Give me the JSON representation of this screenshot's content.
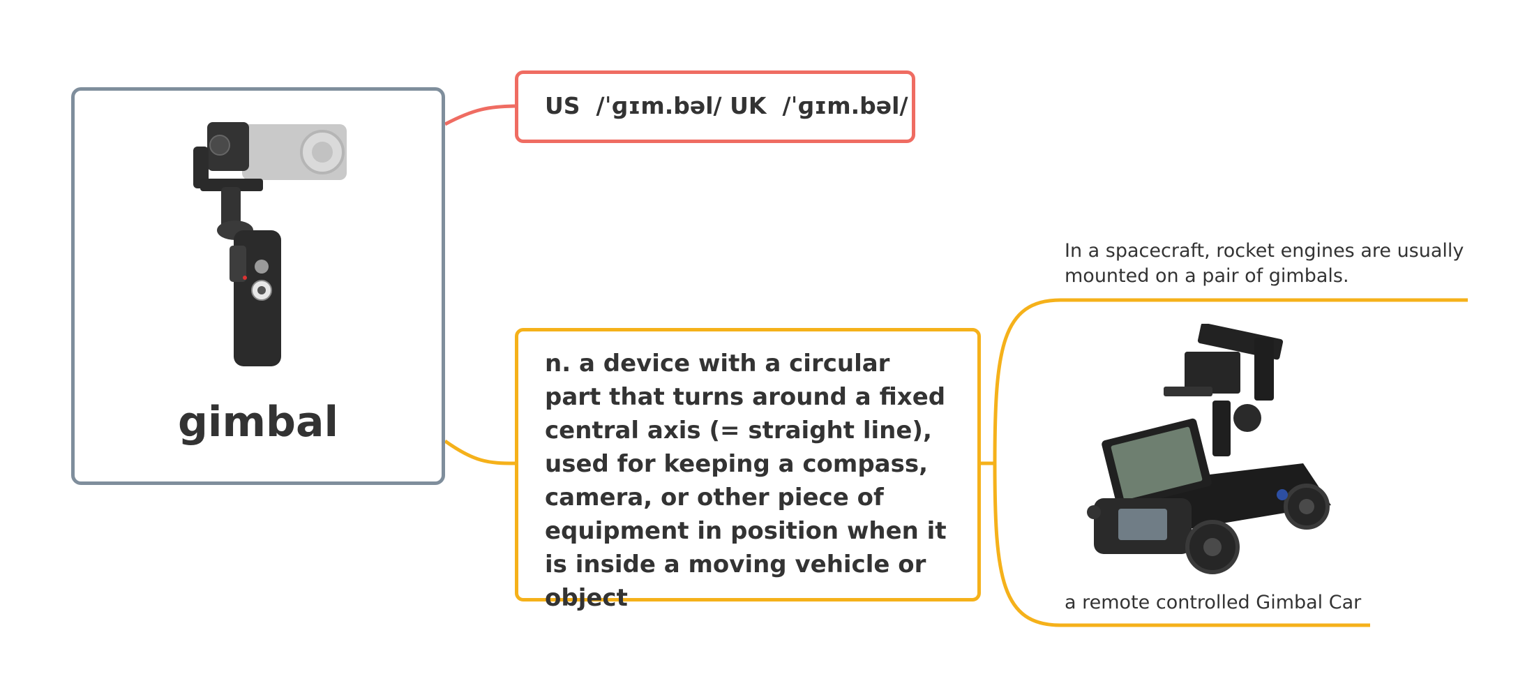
{
  "root": {
    "word": "gimbal",
    "image_icon": "handheld-gimbal-stabilizer-icon",
    "border_color": "#7f8e9c"
  },
  "pronunciation": {
    "text": "US  /ˈɡɪm.bəl/ UK  /ˈɡɪm.bəl/",
    "border_color": "#ef6c62"
  },
  "definition": {
    "text": "n. a device with a circular part that turns around a fixed central axis (= straight line), used for keeping a compass, camera, or other piece of equipment in position when it is inside a moving vehicle or object",
    "border_color": "#f5b11a"
  },
  "example": {
    "text": "In a spacecraft, rocket engines are usually mounted on a pair of gimbals."
  },
  "image_note": {
    "caption": "a remote controlled Gimbal Car",
    "image_icon": "rc-gimbal-car-icon"
  }
}
